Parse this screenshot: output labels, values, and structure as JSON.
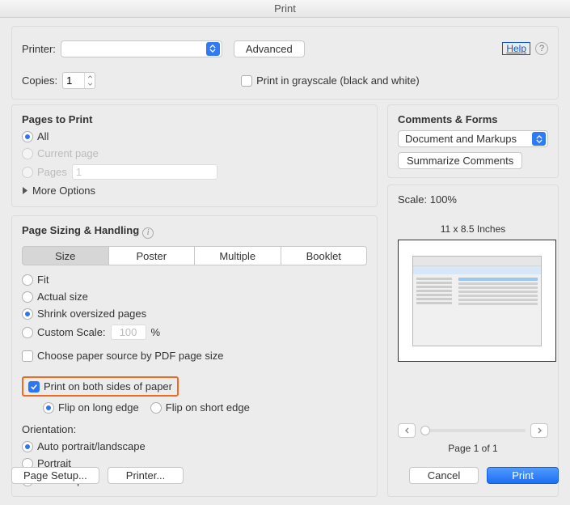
{
  "window": {
    "title": "Print"
  },
  "header": {
    "printer_label": "Printer:",
    "printer_name": " ",
    "advanced": "Advanced",
    "help": "Help",
    "copies_label": "Copies:",
    "copies_value": "1",
    "grayscale": "Print in grayscale (black and white)"
  },
  "pages": {
    "title": "Pages to Print",
    "all": "All",
    "current": "Current page",
    "pages_label": "Pages",
    "pages_value": "1",
    "more": "More Options"
  },
  "sizing": {
    "title": "Page Sizing & Handling",
    "tabs": {
      "size": "Size",
      "poster": "Poster",
      "multiple": "Multiple",
      "booklet": "Booklet"
    },
    "fit": "Fit",
    "actual": "Actual size",
    "shrink": "Shrink oversized pages",
    "custom": "Custom Scale:",
    "custom_val": "100",
    "custom_pct": "%",
    "choose_paper": "Choose paper source by PDF page size",
    "duplex": "Print on both sides of paper",
    "flip_long": "Flip on long edge",
    "flip_short": "Flip on short edge",
    "orientation": "Orientation:",
    "auto": "Auto portrait/landscape",
    "portrait": "Portrait",
    "landscape": "Landscape"
  },
  "comments": {
    "title": "Comments & Forms",
    "select": "Document and Markups",
    "summarize": "Summarize Comments"
  },
  "preview": {
    "scale": "Scale: 100%",
    "dims": "11 x 8.5 Inches",
    "page": "Page 1 of 1"
  },
  "footer": {
    "page_setup": "Page Setup...",
    "printer": "Printer...",
    "cancel": "Cancel",
    "print": "Print"
  }
}
